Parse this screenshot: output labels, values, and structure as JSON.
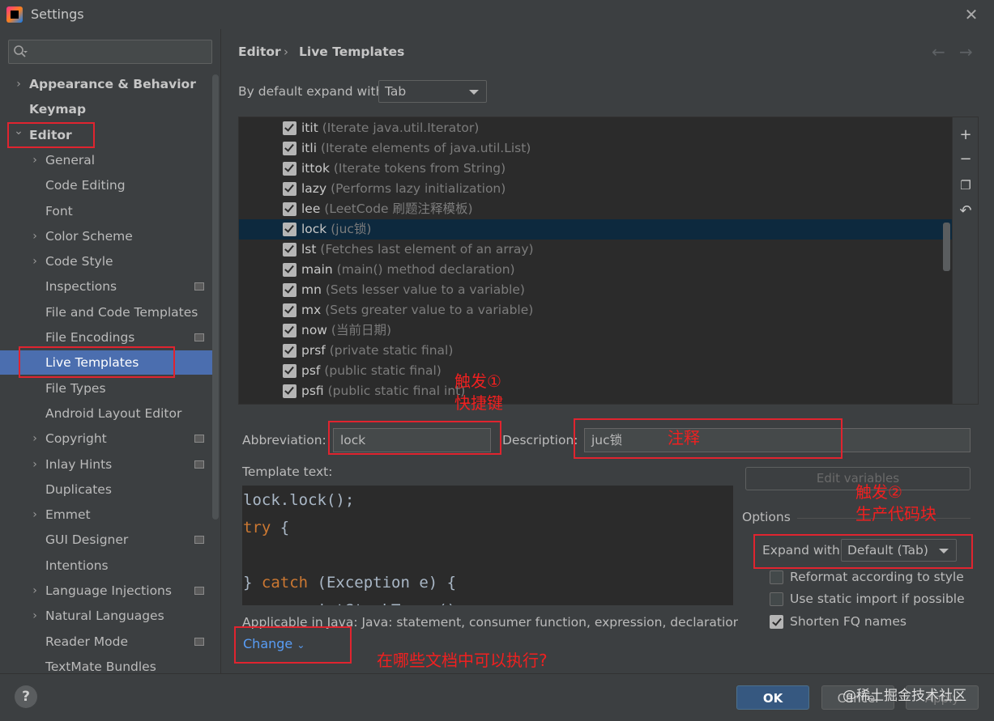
{
  "window": {
    "title": "Settings"
  },
  "sidebar": {
    "search_placeholder": "",
    "items": [
      {
        "label": "Appearance & Behavior",
        "expandable": true,
        "bold": true
      },
      {
        "label": "Keymap",
        "expandable": false,
        "bold": true
      },
      {
        "label": "Editor",
        "expandable": true,
        "expanded": true,
        "bold": true
      },
      {
        "label": "General",
        "expandable": true
      },
      {
        "label": "Code Editing"
      },
      {
        "label": "Font"
      },
      {
        "label": "Color Scheme",
        "expandable": true
      },
      {
        "label": "Code Style",
        "expandable": true
      },
      {
        "label": "Inspections",
        "badge": true
      },
      {
        "label": "File and Code Templates"
      },
      {
        "label": "File Encodings",
        "badge": true
      },
      {
        "label": "Live Templates",
        "selected": true
      },
      {
        "label": "File Types"
      },
      {
        "label": "Android Layout Editor"
      },
      {
        "label": "Copyright",
        "expandable": true,
        "badge": true
      },
      {
        "label": "Inlay Hints",
        "expandable": true,
        "badge": true
      },
      {
        "label": "Duplicates"
      },
      {
        "label": "Emmet",
        "expandable": true
      },
      {
        "label": "GUI Designer",
        "badge": true
      },
      {
        "label": "Intentions"
      },
      {
        "label": "Language Injections",
        "expandable": true,
        "badge": true
      },
      {
        "label": "Natural Languages",
        "expandable": true
      },
      {
        "label": "Reader Mode",
        "badge": true
      },
      {
        "label": "TextMate Bundles"
      }
    ]
  },
  "breadcrumb": {
    "parent": "Editor",
    "separator": "›",
    "current": "Live Templates"
  },
  "expand_default": {
    "label": "By default expand with",
    "value": "Tab"
  },
  "templates": [
    {
      "name": "itit",
      "desc": "(Iterate java.util.Iterator)",
      "checked": true
    },
    {
      "name": "itli",
      "desc": "(Iterate elements of java.util.List)",
      "checked": true
    },
    {
      "name": "ittok",
      "desc": "(Iterate tokens from String)",
      "checked": true
    },
    {
      "name": "lazy",
      "desc": "(Performs lazy initialization)",
      "checked": true
    },
    {
      "name": "lee",
      "desc": "(LeetCode 刷题注释模板)",
      "checked": true
    },
    {
      "name": "lock",
      "desc": "(juc锁)",
      "checked": true,
      "selected": true
    },
    {
      "name": "lst",
      "desc": "(Fetches last element of an array)",
      "checked": true
    },
    {
      "name": "main",
      "desc": "(main() method declaration)",
      "checked": true
    },
    {
      "name": "mn",
      "desc": "(Sets lesser value to a variable)",
      "checked": true
    },
    {
      "name": "mx",
      "desc": "(Sets greater value to a variable)",
      "checked": true
    },
    {
      "name": "now",
      "desc": "(当前日期)",
      "checked": true
    },
    {
      "name": "prsf",
      "desc": "(private static final)",
      "checked": true
    },
    {
      "name": "psf",
      "desc": "(public static final)",
      "checked": true
    },
    {
      "name": "psfi",
      "desc": "(public static final int)",
      "checked": true
    }
  ],
  "toolbar_icons": [
    "add-icon",
    "remove-icon",
    "copy-icon",
    "restore-icon"
  ],
  "form": {
    "abbreviation_label": "Abbreviation:",
    "abbreviation_value": "lock",
    "description_label": "Description:",
    "description_value": "juc锁",
    "template_text_label": "Template text:",
    "code_lines": [
      "lock.lock();",
      "try {",
      "",
      "} catch (Exception e) {",
      "    e.printStackTrace();"
    ],
    "applicable_text": "Applicable in Java: Java: statement, consumer function, expression, declaration, co...",
    "change_link": "Change",
    "edit_variables_button": "Edit variables"
  },
  "options": {
    "header": "Options",
    "expand_with_label": "Expand with",
    "expand_with_value": "Default (Tab)",
    "reformat_label": "Reformat according to style",
    "reformat_checked": false,
    "static_import_label": "Use static import if possible",
    "static_import_checked": false,
    "shorten_fq_label": "Shorten FQ names",
    "shorten_fq_checked": true
  },
  "annotations": {
    "trigger1_line1": "触发①",
    "trigger1_line2": "快捷键",
    "comment": "注释",
    "trigger2_line1": "触发②",
    "trigger2_line2": "生产代码块",
    "where": "在哪些文档中可以执行?"
  },
  "buttons": {
    "help": "?",
    "ok": "OK",
    "cancel": "Cancel",
    "apply": "Apply"
  },
  "watermark": "@稀土掘金技术社区",
  "colors": {
    "accent": "#4b6eaf",
    "annotation_red": "#e0242f",
    "link": "#589df6",
    "keyword": "#cc7832"
  }
}
